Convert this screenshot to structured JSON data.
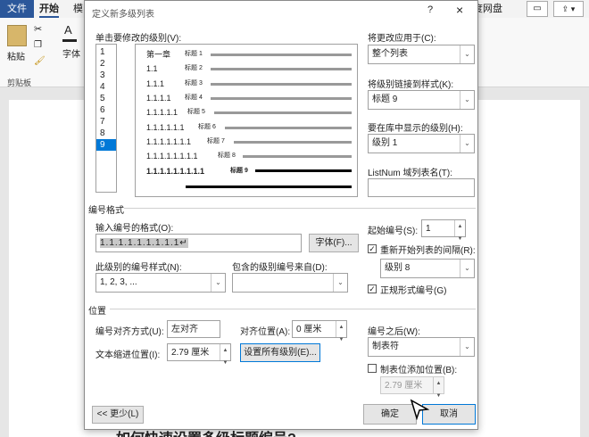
{
  "ribbon": {
    "tab_file": "文件",
    "tab_home": "开始",
    "tab_more": "模",
    "tab_cloud": "度网盘",
    "paste": "粘贴",
    "clipboard": "剪贴板",
    "font_char": "A",
    "font": "字体"
  },
  "document": {
    "bottom_text": "如何快速设置多级标题编号?"
  },
  "dialog": {
    "title": "定义新多级列表",
    "help": "?",
    "close": "×",
    "level_label": "单击要修改的级别(V):",
    "levels": [
      "1",
      "2",
      "3",
      "4",
      "5",
      "6",
      "7",
      "8",
      "9"
    ],
    "selected_level": "9",
    "preview": [
      {
        "num": "第一章",
        "tag": "标题 1"
      },
      {
        "num": "1.1",
        "tag": "标题 2"
      },
      {
        "num": "1.1.1",
        "tag": "标题 3"
      },
      {
        "num": "1.1.1.1",
        "tag": "标题 4"
      },
      {
        "num": "1.1.1.1.1",
        "tag": "标题 5"
      },
      {
        "num": "1.1.1.1.1.1",
        "tag": "标题 6"
      },
      {
        "num": "1.1.1.1.1.1.1",
        "tag": "标题 7"
      },
      {
        "num": "1.1.1.1.1.1.1.1",
        "tag": "标题 8"
      },
      {
        "num": "1.1.1.1.1.1.1.1.1",
        "tag": "标题 9"
      }
    ],
    "apply_to_label": "将更改应用于(C):",
    "apply_to_value": "整个列表",
    "link_style_label": "将级别链接到样式(K):",
    "link_style_value": "标题 9",
    "gallery_level_label": "要在库中显示的级别(H):",
    "gallery_level_value": "级别 1",
    "listnum_label": "ListNum 域列表名(T):",
    "listnum_value": "",
    "number_format_section": "编号格式",
    "enter_format_label": "输入编号的格式(O):",
    "enter_format_value": "1.1.1.1.1.1.1.1.1↵",
    "font_button": "字体(F)...",
    "number_style_label": "此级别的编号样式(N):",
    "number_style_value": "1, 2, 3, ...",
    "include_level_label": "包含的级别编号来自(D):",
    "include_level_value": "",
    "start_at_label": "起始编号(S):",
    "start_at_value": "1",
    "restart_label": "重新开始列表的间隔(R):",
    "restart_value": "级别 8",
    "legal_label": "正规形式编号(G)",
    "position_section": "位置",
    "align_label": "编号对齐方式(U):",
    "align_value": "左对齐",
    "align_at_label": "对齐位置(A):",
    "align_at_value": "0 厘米",
    "indent_label": "文本缩进位置(I):",
    "indent_value": "2.79 厘米",
    "set_all_button": "设置所有级别(E)...",
    "follow_label": "编号之后(W):",
    "follow_value": "制表符",
    "tab_stop_label": "制表位添加位置(B):",
    "tab_stop_value": "2.79 厘米",
    "less_button": "<< 更少(L)",
    "ok_button": "确定",
    "cancel_button": "取消"
  },
  "colors": {
    "accent": "#0078d7",
    "brand": "#2b579a"
  },
  "icons": [
    "paste-icon",
    "cut-icon",
    "copy-icon",
    "format-painter-icon",
    "comment-icon",
    "share-icon",
    "cursor-icon"
  ]
}
